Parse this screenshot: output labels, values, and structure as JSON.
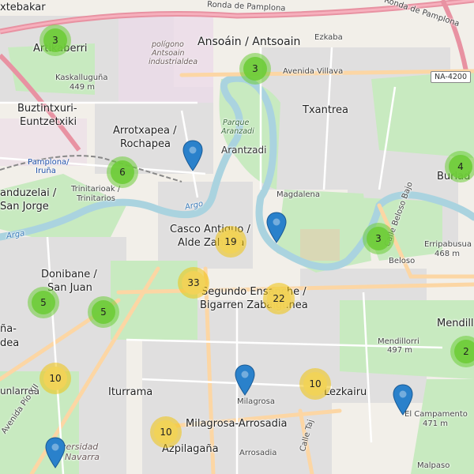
{
  "map": {
    "labels": {
      "artikaberri_top": "xtebakar",
      "artikaberri": "Artikaberri",
      "kaskalluguna": "Kaskalluguña",
      "kaskalluguna_elev": "449 m",
      "buztintxuri": "Buztintxuri-",
      "euntzetxiki": "Euntzetxiki",
      "pamplona_station": "Pamplona/",
      "pamplona_station2": "Iruña",
      "landuzelai": "anduzelai /",
      "san_jorge": "San Jorge",
      "arga_west": "Arga",
      "donibane": "Donibane /",
      "san_juan": "San Juan",
      "ermitagana": "ña-",
      "ea": "dea",
      "unlarrea": "unlarrea",
      "ronda_pamplona1": "Ronda de Pamplona",
      "ronda_pamplona2": "Ronda de Pamplona",
      "poligono1": "polígono",
      "poligono2": "Antsoain",
      "poligono3": "industrialdea",
      "ansoain": "Ansoáin / Antsoain",
      "ezkaba": "Ezkaba",
      "avenida_villava": "Avenida Villava",
      "na4200": "NA-4200",
      "arrotxapea": "Arrotxapea /",
      "rochapea": "Rochapea",
      "parque1": "Parque",
      "parque2": "Aranzadi",
      "txantrea": "Txantrea",
      "arantzadi": "Arantzadi",
      "trinitarioak": "Trinitarioak /",
      "trinitarios": "Trinitarios",
      "argo": "Argo",
      "magdalena": "Magdalena",
      "burlada": "Burlad",
      "calle_beloso": "Calle Beloso Bajo",
      "erripabusua": "Erripabusua",
      "erripabusua_elev": "468 m",
      "beloso": "Beloso",
      "casco1": "Casco Antiguo /",
      "casco2": "Alde Zaharra",
      "segundo1": "Segundo Ensanche /",
      "segundo2": "Bigarren Zabalgunea",
      "mendillorri": "Mendillorri",
      "mendillorri_elev": "497 m",
      "mendill_right": "Mendill",
      "iturrama": "Iturrama",
      "milagrosa": "Milagrosa",
      "milagrosa_arrosadia": "Milagrosa-Arrosadia",
      "lezkairu": "Lezkairu",
      "el_campamento": "El Campamento",
      "el_campamento_elev": "471 m",
      "azpilagana": "Azpilagaña",
      "arrosadia": "Arrosadia",
      "universidad1": "versidad",
      "universidad2": "Navarra",
      "calle_tajonar": "Calle Taj",
      "malpaso": "Malpaso",
      "avenida_pio": "Avenida Pío XII"
    },
    "clusters": [
      {
        "id": "c1",
        "count": "3",
        "color": "green"
      },
      {
        "id": "c2",
        "count": "3",
        "color": "green"
      },
      {
        "id": "c3",
        "count": "6",
        "color": "green"
      },
      {
        "id": "c4",
        "count": "4",
        "color": "green"
      },
      {
        "id": "c5",
        "count": "19",
        "color": "yellow"
      },
      {
        "id": "c6",
        "count": "3",
        "color": "green"
      },
      {
        "id": "c7",
        "count": "33",
        "color": "yellow"
      },
      {
        "id": "c8",
        "count": "22",
        "color": "yellow"
      },
      {
        "id": "c9",
        "count": "5",
        "color": "green"
      },
      {
        "id": "c10",
        "count": "5",
        "color": "green"
      },
      {
        "id": "c11",
        "count": "2",
        "color": "green"
      },
      {
        "id": "c12",
        "count": "10",
        "color": "yellow"
      },
      {
        "id": "c13",
        "count": "10",
        "color": "yellow"
      },
      {
        "id": "c14",
        "count": "10",
        "color": "yellow"
      }
    ],
    "colors": {
      "park": "#c8eac0",
      "residential": "#e0dfdf",
      "water": "#aad3df",
      "primary_road": "#fcd6a4",
      "motorway": "#e892a2",
      "pin": "#2a81cb",
      "cluster_green": "#6ecc39",
      "cluster_yellow": "#f1c40f"
    }
  }
}
